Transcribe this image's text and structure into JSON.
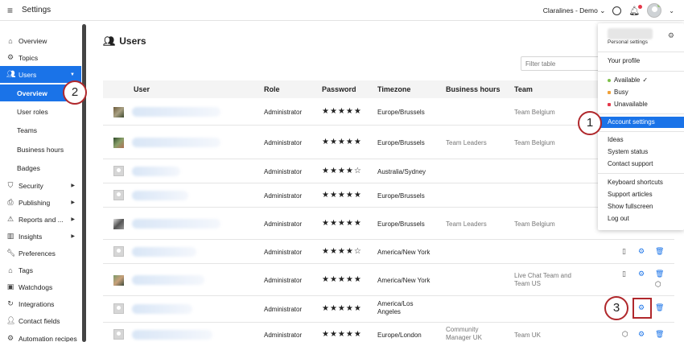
{
  "app": {
    "title": "Settings",
    "account_name": "Claralines - Demo"
  },
  "colors": {
    "accent": "#1a73e8",
    "callout": "#b0282c",
    "available": "#7ec04a",
    "busy": "#f0a13a",
    "unavailable": "#e5384a"
  },
  "sidebar": {
    "items": [
      {
        "label": "Overview",
        "icon": "home-icon"
      },
      {
        "label": "Topics",
        "icon": "gear-icon"
      },
      {
        "label": "Users",
        "icon": "users-icon"
      },
      {
        "label": "Overview",
        "icon": ""
      },
      {
        "label": "User roles",
        "icon": ""
      },
      {
        "label": "Teams",
        "icon": ""
      },
      {
        "label": "Business hours",
        "icon": ""
      },
      {
        "label": "Badges",
        "icon": ""
      },
      {
        "label": "Security",
        "icon": "shield-icon"
      },
      {
        "label": "Publishing",
        "icon": "publish-icon"
      },
      {
        "label": "Reports and ...",
        "icon": "warning-icon"
      },
      {
        "label": "Insights",
        "icon": "chart-icon"
      },
      {
        "label": "Preferences",
        "icon": "wrench-icon"
      },
      {
        "label": "Tags",
        "icon": "tag-icon"
      },
      {
        "label": "Watchdogs",
        "icon": "watchdog-icon"
      },
      {
        "label": "Integrations",
        "icon": "refresh-icon"
      },
      {
        "label": "Contact fields",
        "icon": "contact-icon"
      },
      {
        "label": "Automation recipes",
        "icon": "gear-icon"
      }
    ]
  },
  "main": {
    "title": "Users",
    "filter_placeholder": "Filter table",
    "columns": [
      "User",
      "Role",
      "Password",
      "Timezone",
      "Business hours",
      "Team"
    ],
    "rows": [
      {
        "role": "Administrator",
        "password": "★★★★★",
        "timezone": "Europe/Brussels",
        "hours": "",
        "team": "Team Belgium"
      },
      {
        "role": "Administrator",
        "password": "★★★★★",
        "timezone": "Europe/Brussels",
        "hours": "Team Leaders",
        "team": "Team Belgium"
      },
      {
        "role": "Administrator",
        "password": "★★★★☆",
        "timezone": "Australia/Sydney",
        "hours": "",
        "team": ""
      },
      {
        "role": "Administrator",
        "password": "★★★★★",
        "timezone": "Europe/Brussels",
        "hours": "",
        "team": ""
      },
      {
        "role": "Administrator",
        "password": "★★★★★",
        "timezone": "Europe/Brussels",
        "hours": "Team Leaders",
        "team": "Team Belgium"
      },
      {
        "role": "Administrator",
        "password": "★★★★☆",
        "timezone": "America/New York",
        "hours": "",
        "team": ""
      },
      {
        "role": "Administrator",
        "password": "★★★★★",
        "timezone": "America/New York",
        "hours": "",
        "team": "Live Chat Team and Team US"
      },
      {
        "role": "Administrator",
        "password": "★★★★★",
        "timezone": "America/Los Angeles",
        "hours": "",
        "team": ""
      },
      {
        "role": "Administrator",
        "password": "★★★★★",
        "timezone": "Europe/London",
        "hours": "Community Manager UK",
        "team": "Team UK"
      }
    ]
  },
  "dropdown": {
    "personal_settings": "Personal settings",
    "your_profile": "Your profile",
    "available": "Available",
    "busy": "Busy",
    "unavailable": "Unavailable",
    "account_settings": "Account settings",
    "ideas": "Ideas",
    "system_status": "System status",
    "contact_support": "Contact support",
    "keyboard_shortcuts": "Keyboard shortcuts",
    "support_articles": "Support articles",
    "show_fullscreen": "Show fullscreen",
    "log_out": "Log out"
  },
  "callouts": {
    "one": "1",
    "two": "2",
    "three": "3"
  }
}
